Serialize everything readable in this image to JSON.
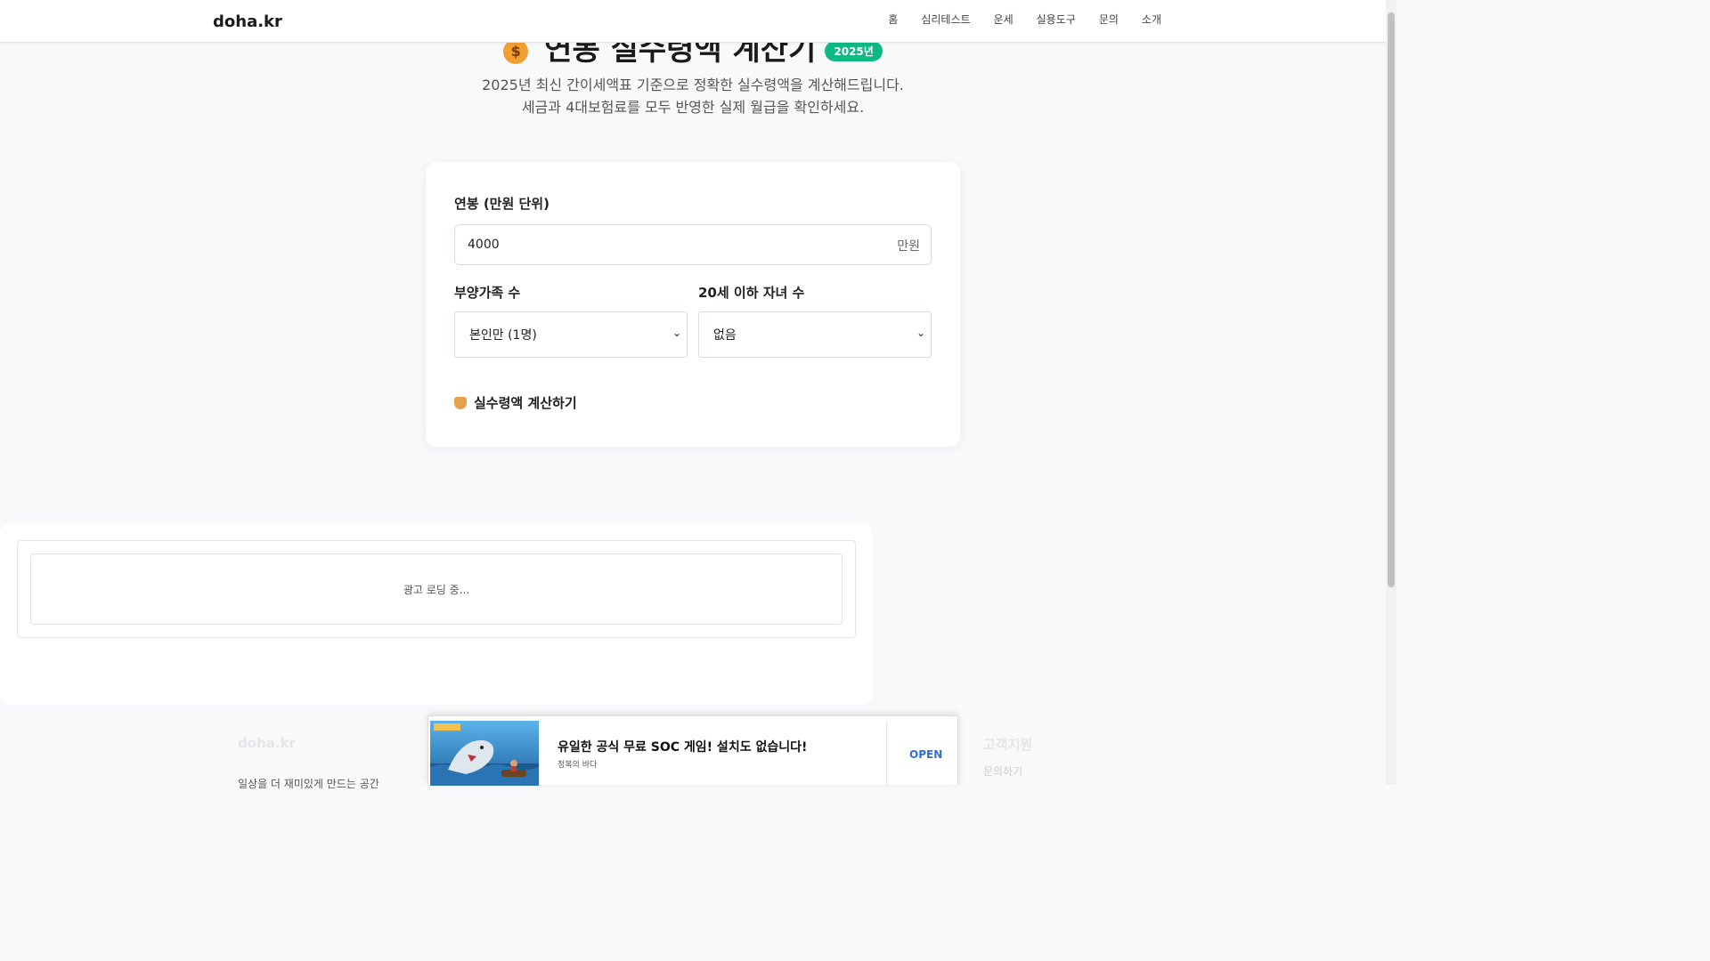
{
  "header": {
    "logo": "doha.kr",
    "nav": [
      "홈",
      "심리테스트",
      "운세",
      "실용도구",
      "문의",
      "소개"
    ]
  },
  "hero": {
    "title": "연봉 실수령액 계산기",
    "badge": "2025년",
    "subtitle_line1": "2025년 최신 간이세액표 기준으로 정확한 실수령액을 계산해드립니다.",
    "subtitle_line2": "세금과 4대보험료를 모두 반영한 실제 월급을 확인하세요."
  },
  "calculator": {
    "salary_label": "연봉 (만원 단위)",
    "salary_value": "4000",
    "salary_unit": "만원",
    "dependents_label": "부양가족 수",
    "dependents_selected": "본인만 (1명)",
    "children_label": "20세 이하 자녀 수",
    "children_selected": "없음",
    "calculate_button": "실수령액 계산하기"
  },
  "ad": {
    "loading_text": "광고 로딩 중..."
  },
  "footer": {
    "brand": "doha.kr",
    "description": "일상을 더 재미있게 만드는 공간",
    "policy_title": "고객지원",
    "contact_link": "문의하기"
  },
  "banner": {
    "title": "유일한 공식 무료 SOC 게임! 설치도 없습니다!",
    "subtitle": "정복의 바다",
    "open_button": "OPEN"
  },
  "colors": {
    "accent_badge": "#10b981",
    "open_button": "#2f6fd6",
    "page_bg": "#f8f9fb"
  }
}
